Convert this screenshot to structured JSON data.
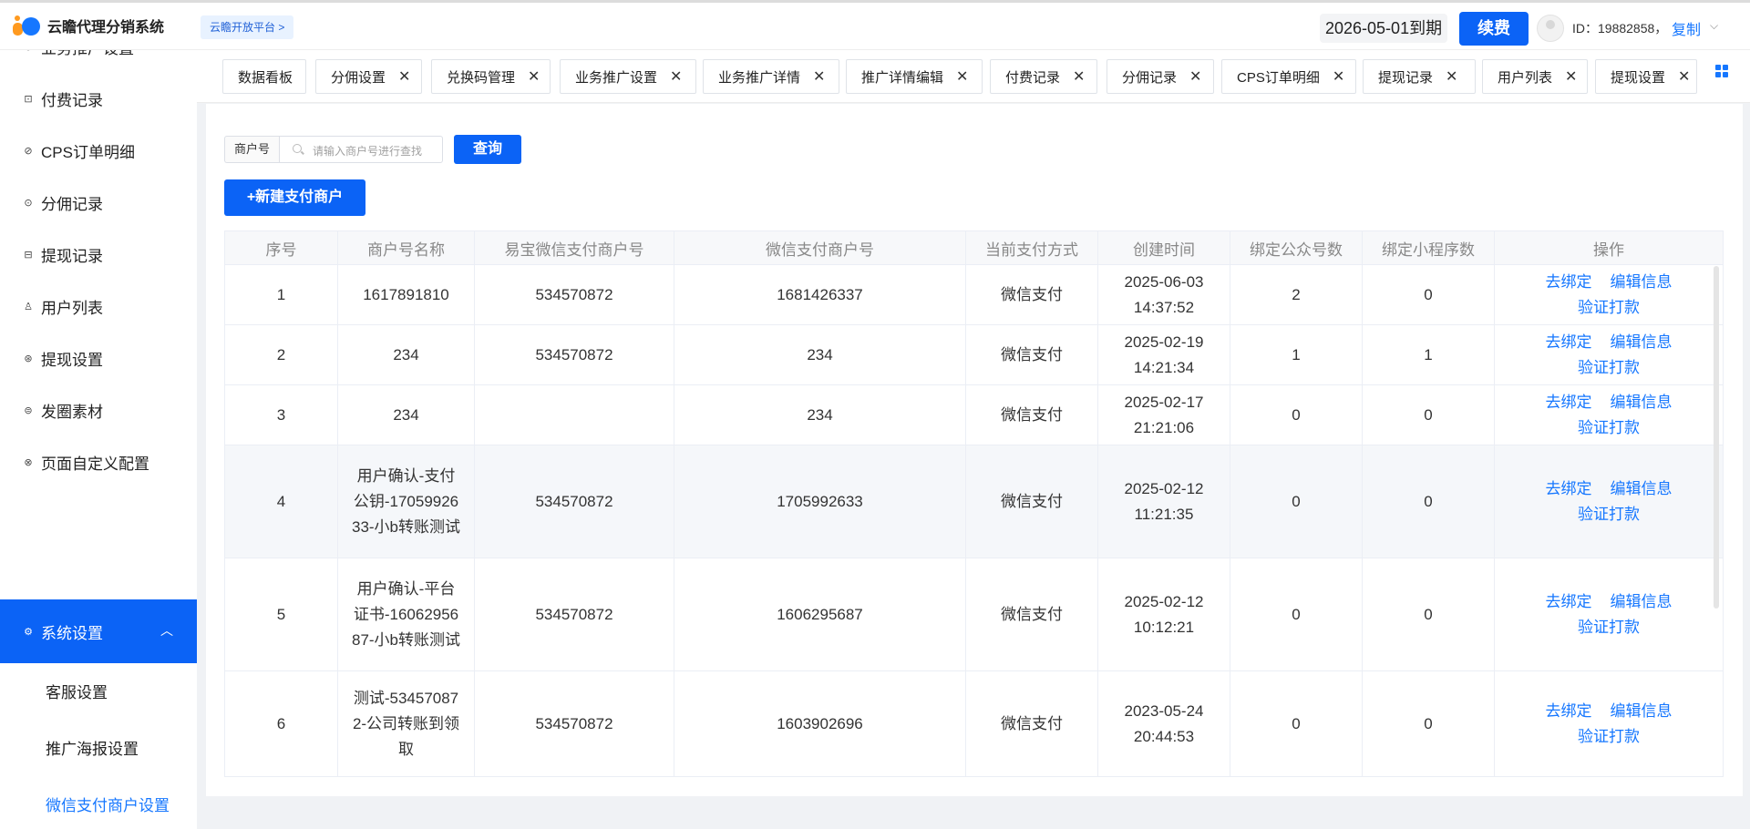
{
  "header": {
    "app_name": "云瞻代理分销系统",
    "platform_link": "云瞻开放平台 >",
    "expiry": "2026-05-01到期",
    "renew_label": "续费",
    "user_id": "ID：19882858，",
    "copy_label": "复制",
    "caret": "⌵"
  },
  "sidebar": {
    "items": [
      {
        "label": "业务推广设置",
        "icon": "⊖"
      },
      {
        "label": "付费记录",
        "icon": "⊡"
      },
      {
        "label": "CPS订单明细",
        "icon": "⊘"
      },
      {
        "label": "分佣记录",
        "icon": "⊙"
      },
      {
        "label": "提现记录",
        "icon": "⊟"
      },
      {
        "label": "用户列表",
        "icon": "♙"
      },
      {
        "label": "提现设置",
        "icon": "⊛"
      },
      {
        "label": "发圈素材",
        "icon": "⊜"
      },
      {
        "label": "页面自定义配置",
        "icon": "⊗"
      }
    ],
    "active": {
      "label": "系统设置",
      "icon": "⚙",
      "caret": "︿"
    },
    "sub_items": [
      {
        "label": "客服设置"
      },
      {
        "label": "推广海报设置"
      },
      {
        "label": "微信支付商户设置"
      }
    ]
  },
  "tabs": [
    {
      "label": "数据看板",
      "closable": false
    },
    {
      "label": "分佣设置",
      "closable": true
    },
    {
      "label": "兑换码管理",
      "closable": true
    },
    {
      "label": "业务推广设置",
      "closable": true
    },
    {
      "label": "业务推广详情",
      "closable": true
    },
    {
      "label": "推广详情编辑",
      "closable": true
    },
    {
      "label": "付费记录",
      "closable": true
    },
    {
      "label": "分佣记录",
      "closable": true
    },
    {
      "label": "CPS订单明细",
      "closable": true
    },
    {
      "label": "提现记录",
      "closable": true
    },
    {
      "label": "用户列表",
      "closable": true
    },
    {
      "label": "提现设置",
      "closable": true
    }
  ],
  "tab_close_glyph": "✕",
  "search": {
    "label": "商户号",
    "placeholder": "请输入商户号进行查找",
    "query_label": "查询",
    "new_label": "+新建支付商户"
  },
  "table": {
    "headers": [
      "序号",
      "商户号名称",
      "易宝微信支付商户号",
      "微信支付商户号",
      "当前支付方式",
      "创建时间",
      "绑定公众号数",
      "绑定小程序数",
      "操作"
    ],
    "rows": [
      {
        "no": "1",
        "name": "1617891810",
        "yibao": "534570872",
        "wechat": "1681426337",
        "method": "微信支付",
        "date": "2025-06-03",
        "time": "14:37:52",
        "mp": "2",
        "mini": "0"
      },
      {
        "no": "2",
        "name": "234",
        "yibao": "534570872",
        "wechat": "234",
        "method": "微信支付",
        "date": "2025-02-19",
        "time": "14:21:34",
        "mp": "1",
        "mini": "1"
      },
      {
        "no": "3",
        "name": "234",
        "yibao": "",
        "wechat": "234",
        "method": "微信支付",
        "date": "2025-02-17",
        "time": "21:21:06",
        "mp": "0",
        "mini": "0"
      },
      {
        "no": "4",
        "name": "用户确认-支付公钥-1705992633-小b转账测试",
        "yibao": "534570872",
        "wechat": "1705992633",
        "method": "微信支付",
        "date": "2025-02-12",
        "time": "11:21:35",
        "mp": "0",
        "mini": "0"
      },
      {
        "no": "5",
        "name": "用户确认-平台证书-1606295687-小b转账测试",
        "yibao": "534570872",
        "wechat": "1606295687",
        "method": "微信支付",
        "date": "2025-02-12",
        "time": "10:12:21",
        "mp": "0",
        "mini": "0"
      },
      {
        "no": "6",
        "name": "测试-534570872-公司转账到领取",
        "yibao": "534570872",
        "wechat": "1603902696",
        "method": "微信支付",
        "date": "2023-05-24",
        "time": "20:44:53",
        "mp": "0",
        "mini": "0"
      }
    ],
    "actions": {
      "unbind": "去绑定",
      "edit": "编辑信息",
      "verify": "验证打款"
    }
  }
}
